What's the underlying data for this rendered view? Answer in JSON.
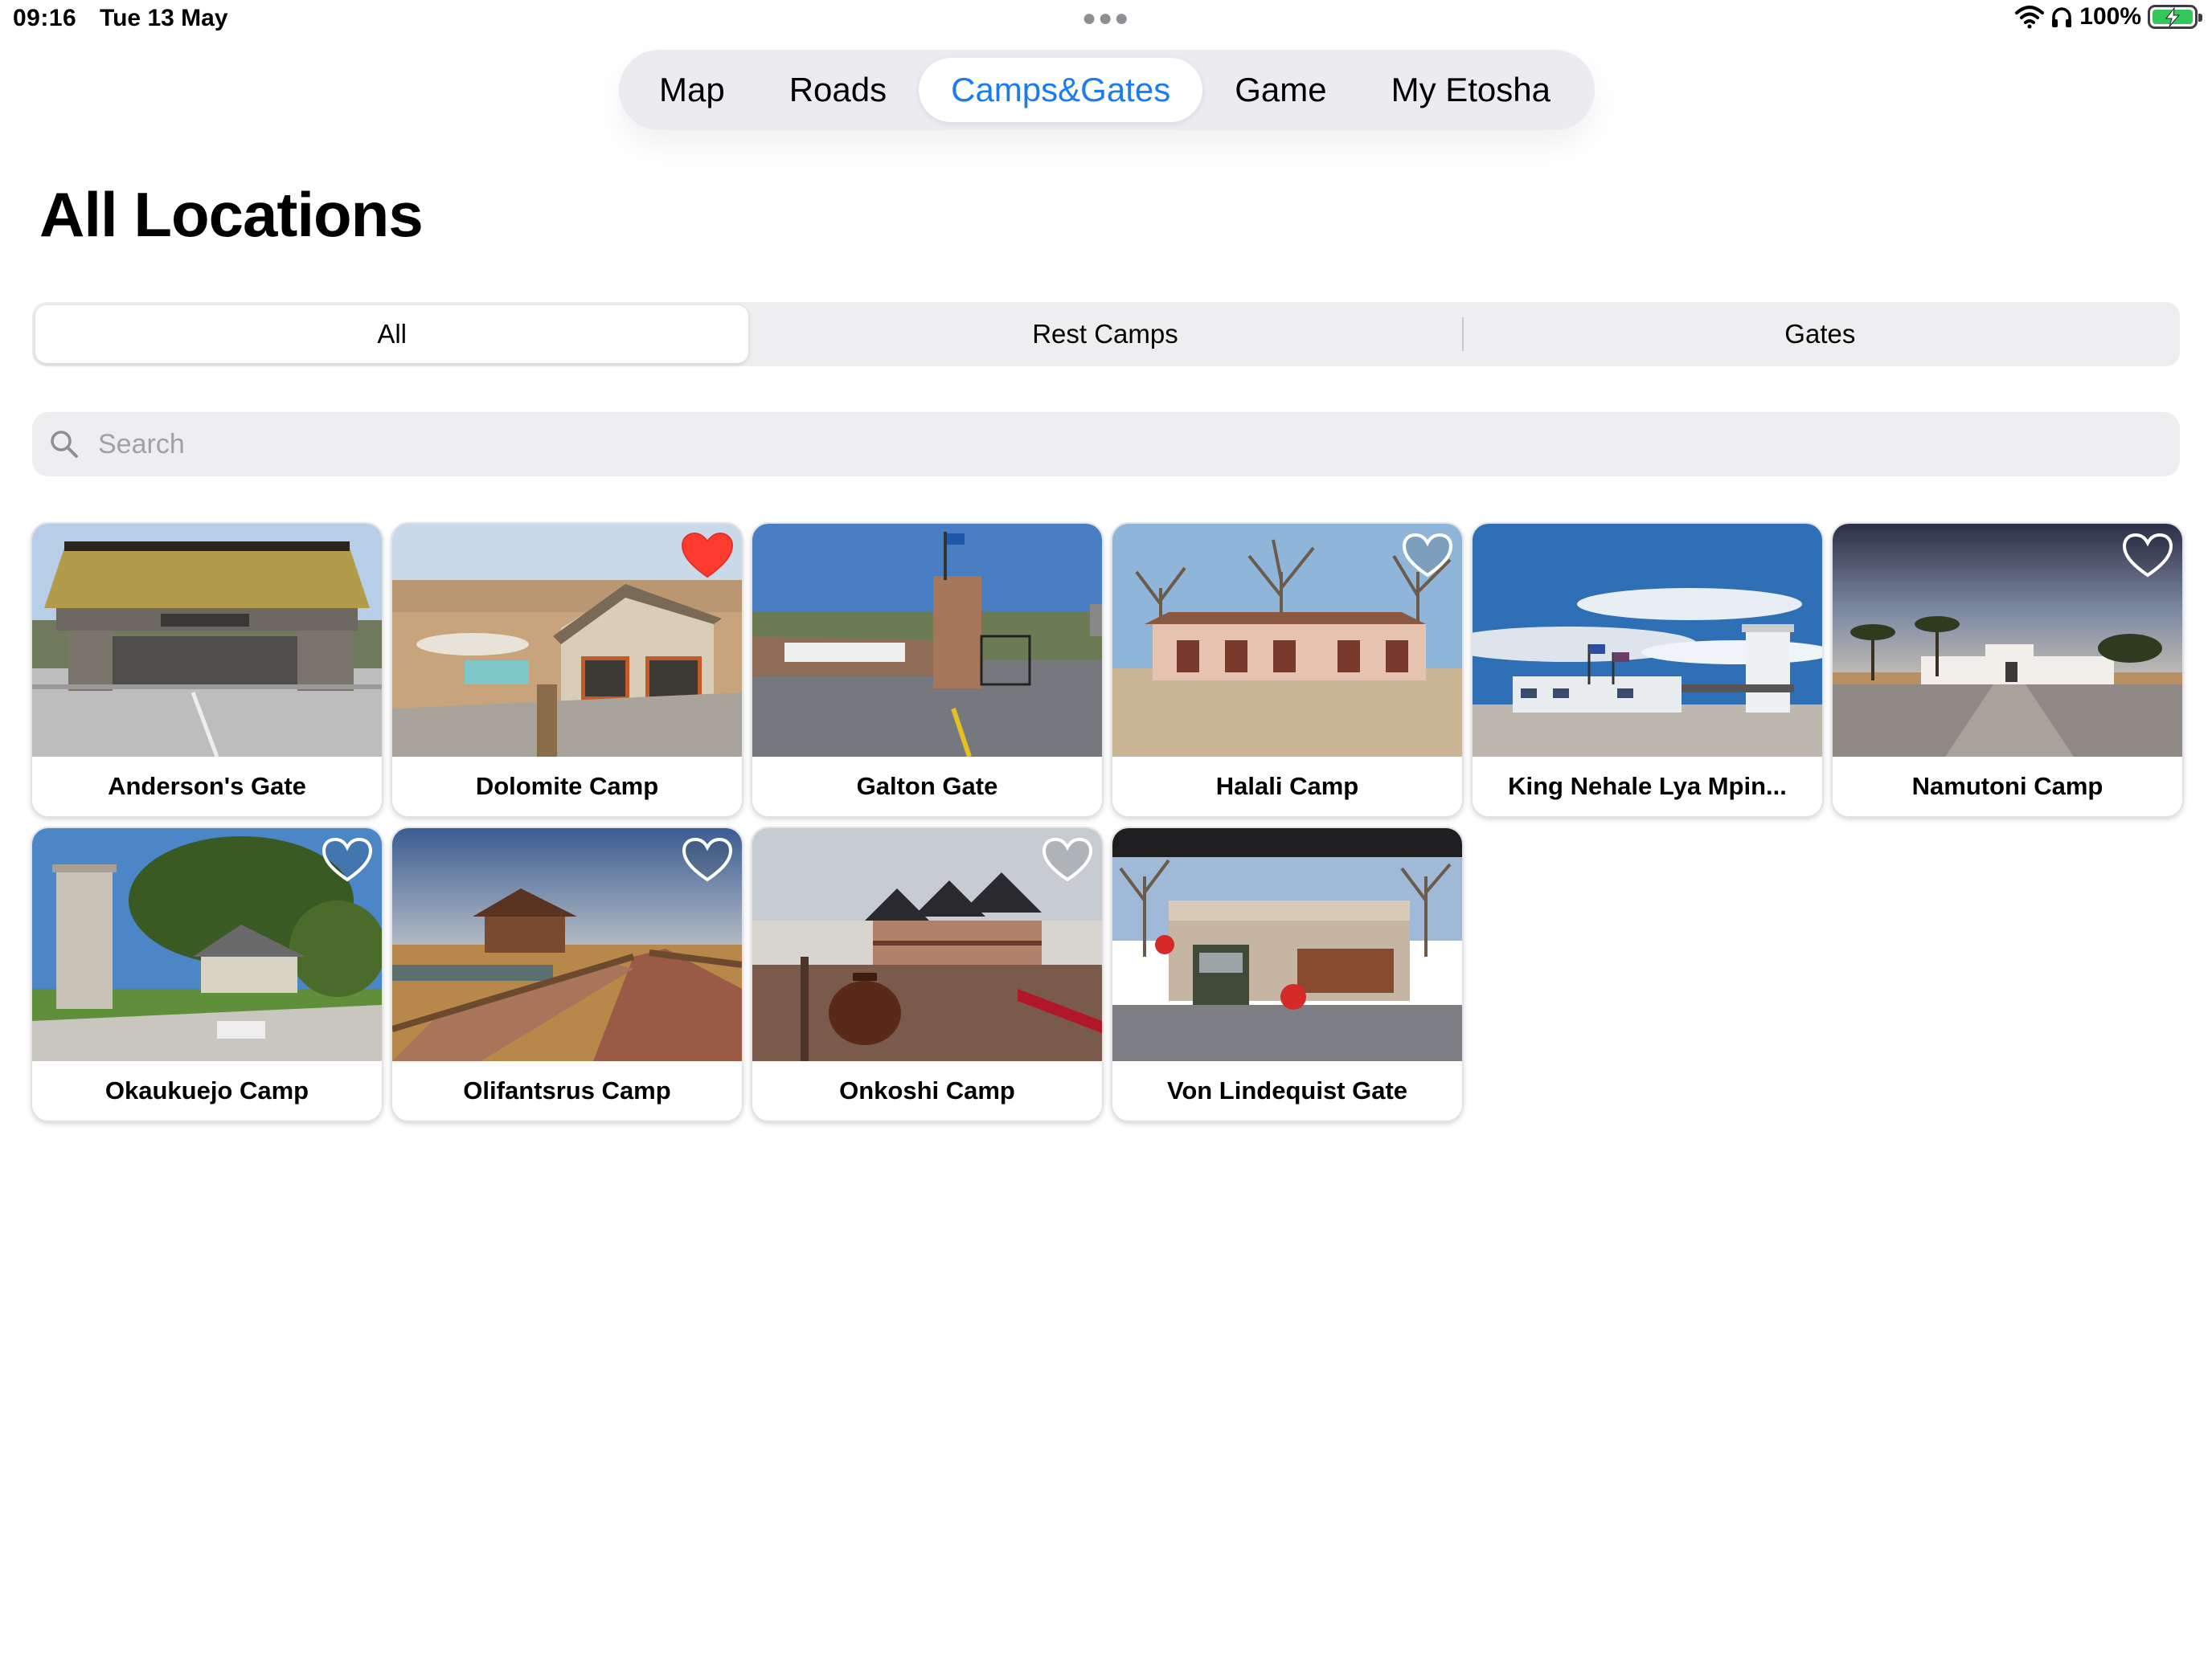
{
  "status_bar": {
    "time": "09:16",
    "date": "Tue 13 May",
    "battery": "100%",
    "icons": [
      "wifi-icon",
      "headphones-icon",
      "battery-charging-icon"
    ]
  },
  "top_tabs": [
    {
      "label": "Map",
      "active": false
    },
    {
      "label": "Roads",
      "active": false
    },
    {
      "label": "Camps&Gates",
      "active": true
    },
    {
      "label": "Game",
      "active": false
    },
    {
      "label": "My Etosha",
      "active": false
    }
  ],
  "page_title": "All Locations",
  "filter": {
    "segments": [
      "All",
      "Rest Camps",
      "Gates"
    ],
    "selected": "All"
  },
  "search": {
    "placeholder": "Search",
    "value": ""
  },
  "locations": [
    {
      "name": "Anderson's Gate",
      "favorite": false,
      "show_heart": false
    },
    {
      "name": "Dolomite Camp",
      "favorite": true,
      "show_heart": true
    },
    {
      "name": "Galton Gate",
      "favorite": false,
      "show_heart": false
    },
    {
      "name": "Halali Camp",
      "favorite": false,
      "show_heart": true
    },
    {
      "name": "King Nehale Lya Mpin...",
      "favorite": false,
      "show_heart": false
    },
    {
      "name": "Namutoni Camp",
      "favorite": false,
      "show_heart": true
    },
    {
      "name": "Okaukuejo Camp",
      "favorite": false,
      "show_heart": true
    },
    {
      "name": "Olifantsrus Camp",
      "favorite": false,
      "show_heart": true
    },
    {
      "name": "Onkoshi Camp",
      "favorite": false,
      "show_heart": true
    },
    {
      "name": "Von Lindequist Gate",
      "favorite": false,
      "show_heart": false
    }
  ],
  "colors": {
    "accent": "#1a7cf0",
    "favorite": "#ff3b30",
    "segment_bg": "#eeeef0",
    "battery": "#34c759"
  }
}
